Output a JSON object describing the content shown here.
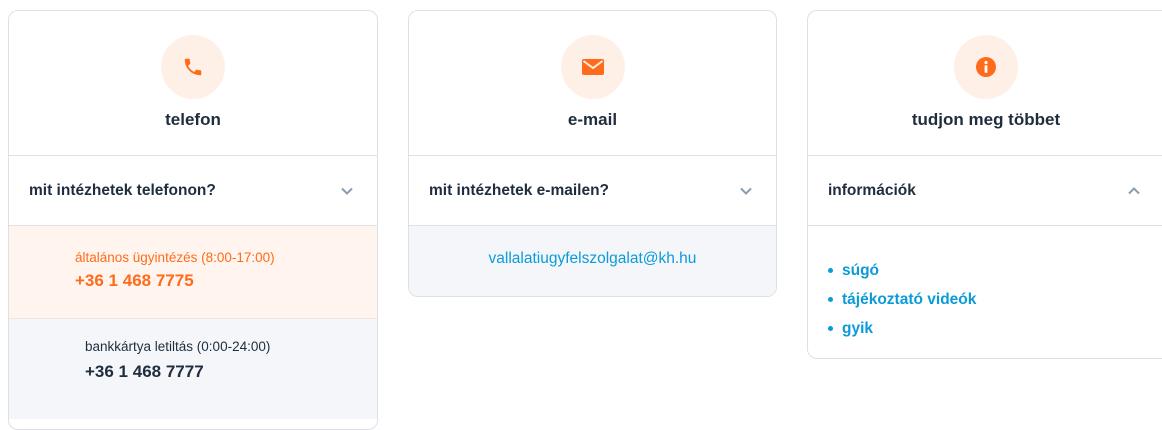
{
  "cards": {
    "phone": {
      "icon": "phone-icon",
      "title": "telefon",
      "accordion_label": "mit intézhetek telefonon?",
      "rows": [
        {
          "label": "általános ügyintézés (8:00-17:00)",
          "number": "+36 1 468 7775"
        },
        {
          "label": "bankkártya letiltás (0:00-24:00)",
          "number": "+36 1 468 7777"
        }
      ]
    },
    "email": {
      "icon": "envelope-icon",
      "title": "e-mail",
      "accordion_label": "mit intézhetek e-mailen?",
      "address": "vallalatiugyfelszolgalat@kh.hu"
    },
    "info": {
      "icon": "info-icon",
      "title": "tudjon meg többet",
      "accordion_label": "információk",
      "links": [
        "súgó",
        "tájékoztató videók",
        "gyik"
      ]
    }
  },
  "colors": {
    "accent_orange": "#ff6b1a",
    "link_blue": "#0a9bd8",
    "text_dark": "#1f2d3d",
    "icon_bg": "#fff0e7"
  }
}
